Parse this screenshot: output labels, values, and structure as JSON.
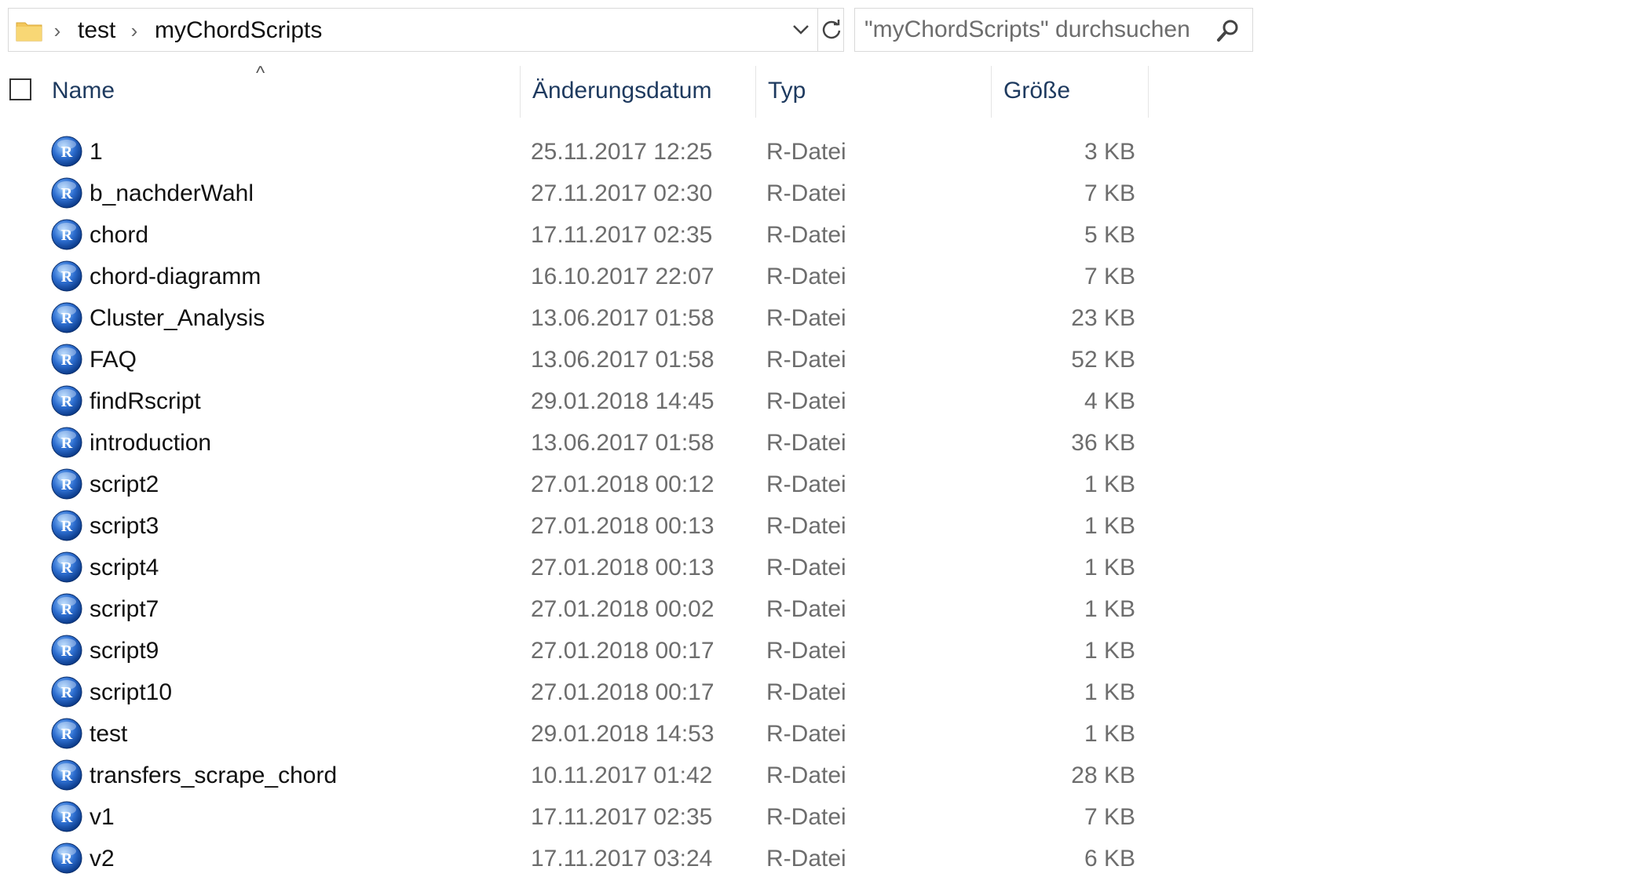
{
  "breadcrumb": {
    "items": [
      "test",
      "myChordScripts"
    ]
  },
  "icons": {
    "folder": "folder-icon",
    "chevron": "chevron-right-icon",
    "dropdown": "chevron-down-icon",
    "refresh": "refresh-icon",
    "search": "search-icon",
    "file": "r-file-icon"
  },
  "search": {
    "placeholder": "\"myChordScripts\" durchsuchen"
  },
  "columns": {
    "name": "Name",
    "date": "Änderungsdatum",
    "type": "Typ",
    "size": "Größe",
    "sort_indicator": "^"
  },
  "files": [
    {
      "name": "1",
      "date": "25.11.2017 12:25",
      "type": "R-Datei",
      "size": "3 KB"
    },
    {
      "name": "b_nachderWahl",
      "date": "27.11.2017 02:30",
      "type": "R-Datei",
      "size": "7 KB"
    },
    {
      "name": "chord",
      "date": "17.11.2017 02:35",
      "type": "R-Datei",
      "size": "5 KB"
    },
    {
      "name": "chord-diagramm",
      "date": "16.10.2017 22:07",
      "type": "R-Datei",
      "size": "7 KB"
    },
    {
      "name": "Cluster_Analysis",
      "date": "13.06.2017 01:58",
      "type": "R-Datei",
      "size": "23 KB"
    },
    {
      "name": "FAQ",
      "date": "13.06.2017 01:58",
      "type": "R-Datei",
      "size": "52 KB"
    },
    {
      "name": "findRscript",
      "date": "29.01.2018 14:45",
      "type": "R-Datei",
      "size": "4 KB"
    },
    {
      "name": "introduction",
      "date": "13.06.2017 01:58",
      "type": "R-Datei",
      "size": "36 KB"
    },
    {
      "name": "script2",
      "date": "27.01.2018 00:12",
      "type": "R-Datei",
      "size": "1 KB"
    },
    {
      "name": "script3",
      "date": "27.01.2018 00:13",
      "type": "R-Datei",
      "size": "1 KB"
    },
    {
      "name": "script4",
      "date": "27.01.2018 00:13",
      "type": "R-Datei",
      "size": "1 KB"
    },
    {
      "name": "script7",
      "date": "27.01.2018 00:02",
      "type": "R-Datei",
      "size": "1 KB"
    },
    {
      "name": "script9",
      "date": "27.01.2018 00:17",
      "type": "R-Datei",
      "size": "1 KB"
    },
    {
      "name": "script10",
      "date": "27.01.2018 00:17",
      "type": "R-Datei",
      "size": "1 KB"
    },
    {
      "name": "test",
      "date": "29.01.2018 14:53",
      "type": "R-Datei",
      "size": "1 KB"
    },
    {
      "name": "transfers_scrape_chord",
      "date": "10.11.2017 01:42",
      "type": "R-Datei",
      "size": "28 KB"
    },
    {
      "name": "v1",
      "date": "17.11.2017 02:35",
      "type": "R-Datei",
      "size": "7 KB"
    },
    {
      "name": "v2",
      "date": "17.11.2017 03:24",
      "type": "R-Datei",
      "size": "6 KB"
    }
  ],
  "colors": {
    "header_text": "#1e3a5f",
    "secondary_text": "#6d6d6d",
    "border": "#d9d9d9",
    "folder": "#f3c75b",
    "r_icon": "#2e6fd1"
  }
}
